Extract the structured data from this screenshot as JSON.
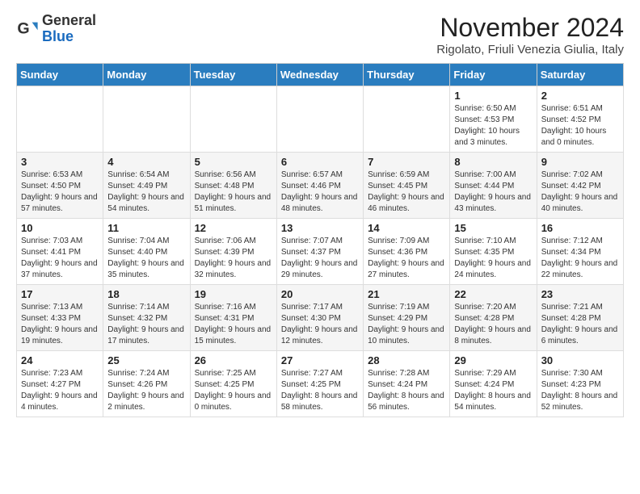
{
  "logo": {
    "general": "General",
    "blue": "Blue"
  },
  "title": "November 2024",
  "subtitle": "Rigolato, Friuli Venezia Giulia, Italy",
  "headers": [
    "Sunday",
    "Monday",
    "Tuesday",
    "Wednesday",
    "Thursday",
    "Friday",
    "Saturday"
  ],
  "rows": [
    [
      {
        "day": "",
        "info": ""
      },
      {
        "day": "",
        "info": ""
      },
      {
        "day": "",
        "info": ""
      },
      {
        "day": "",
        "info": ""
      },
      {
        "day": "",
        "info": ""
      },
      {
        "day": "1",
        "info": "Sunrise: 6:50 AM\nSunset: 4:53 PM\nDaylight: 10 hours and 3 minutes."
      },
      {
        "day": "2",
        "info": "Sunrise: 6:51 AM\nSunset: 4:52 PM\nDaylight: 10 hours and 0 minutes."
      }
    ],
    [
      {
        "day": "3",
        "info": "Sunrise: 6:53 AM\nSunset: 4:50 PM\nDaylight: 9 hours and 57 minutes."
      },
      {
        "day": "4",
        "info": "Sunrise: 6:54 AM\nSunset: 4:49 PM\nDaylight: 9 hours and 54 minutes."
      },
      {
        "day": "5",
        "info": "Sunrise: 6:56 AM\nSunset: 4:48 PM\nDaylight: 9 hours and 51 minutes."
      },
      {
        "day": "6",
        "info": "Sunrise: 6:57 AM\nSunset: 4:46 PM\nDaylight: 9 hours and 48 minutes."
      },
      {
        "day": "7",
        "info": "Sunrise: 6:59 AM\nSunset: 4:45 PM\nDaylight: 9 hours and 46 minutes."
      },
      {
        "day": "8",
        "info": "Sunrise: 7:00 AM\nSunset: 4:44 PM\nDaylight: 9 hours and 43 minutes."
      },
      {
        "day": "9",
        "info": "Sunrise: 7:02 AM\nSunset: 4:42 PM\nDaylight: 9 hours and 40 minutes."
      }
    ],
    [
      {
        "day": "10",
        "info": "Sunrise: 7:03 AM\nSunset: 4:41 PM\nDaylight: 9 hours and 37 minutes."
      },
      {
        "day": "11",
        "info": "Sunrise: 7:04 AM\nSunset: 4:40 PM\nDaylight: 9 hours and 35 minutes."
      },
      {
        "day": "12",
        "info": "Sunrise: 7:06 AM\nSunset: 4:39 PM\nDaylight: 9 hours and 32 minutes."
      },
      {
        "day": "13",
        "info": "Sunrise: 7:07 AM\nSunset: 4:37 PM\nDaylight: 9 hours and 29 minutes."
      },
      {
        "day": "14",
        "info": "Sunrise: 7:09 AM\nSunset: 4:36 PM\nDaylight: 9 hours and 27 minutes."
      },
      {
        "day": "15",
        "info": "Sunrise: 7:10 AM\nSunset: 4:35 PM\nDaylight: 9 hours and 24 minutes."
      },
      {
        "day": "16",
        "info": "Sunrise: 7:12 AM\nSunset: 4:34 PM\nDaylight: 9 hours and 22 minutes."
      }
    ],
    [
      {
        "day": "17",
        "info": "Sunrise: 7:13 AM\nSunset: 4:33 PM\nDaylight: 9 hours and 19 minutes."
      },
      {
        "day": "18",
        "info": "Sunrise: 7:14 AM\nSunset: 4:32 PM\nDaylight: 9 hours and 17 minutes."
      },
      {
        "day": "19",
        "info": "Sunrise: 7:16 AM\nSunset: 4:31 PM\nDaylight: 9 hours and 15 minutes."
      },
      {
        "day": "20",
        "info": "Sunrise: 7:17 AM\nSunset: 4:30 PM\nDaylight: 9 hours and 12 minutes."
      },
      {
        "day": "21",
        "info": "Sunrise: 7:19 AM\nSunset: 4:29 PM\nDaylight: 9 hours and 10 minutes."
      },
      {
        "day": "22",
        "info": "Sunrise: 7:20 AM\nSunset: 4:28 PM\nDaylight: 9 hours and 8 minutes."
      },
      {
        "day": "23",
        "info": "Sunrise: 7:21 AM\nSunset: 4:28 PM\nDaylight: 9 hours and 6 minutes."
      }
    ],
    [
      {
        "day": "24",
        "info": "Sunrise: 7:23 AM\nSunset: 4:27 PM\nDaylight: 9 hours and 4 minutes."
      },
      {
        "day": "25",
        "info": "Sunrise: 7:24 AM\nSunset: 4:26 PM\nDaylight: 9 hours and 2 minutes."
      },
      {
        "day": "26",
        "info": "Sunrise: 7:25 AM\nSunset: 4:25 PM\nDaylight: 9 hours and 0 minutes."
      },
      {
        "day": "27",
        "info": "Sunrise: 7:27 AM\nSunset: 4:25 PM\nDaylight: 8 hours and 58 minutes."
      },
      {
        "day": "28",
        "info": "Sunrise: 7:28 AM\nSunset: 4:24 PM\nDaylight: 8 hours and 56 minutes."
      },
      {
        "day": "29",
        "info": "Sunrise: 7:29 AM\nSunset: 4:24 PM\nDaylight: 8 hours and 54 minutes."
      },
      {
        "day": "30",
        "info": "Sunrise: 7:30 AM\nSunset: 4:23 PM\nDaylight: 8 hours and 52 minutes."
      }
    ]
  ]
}
